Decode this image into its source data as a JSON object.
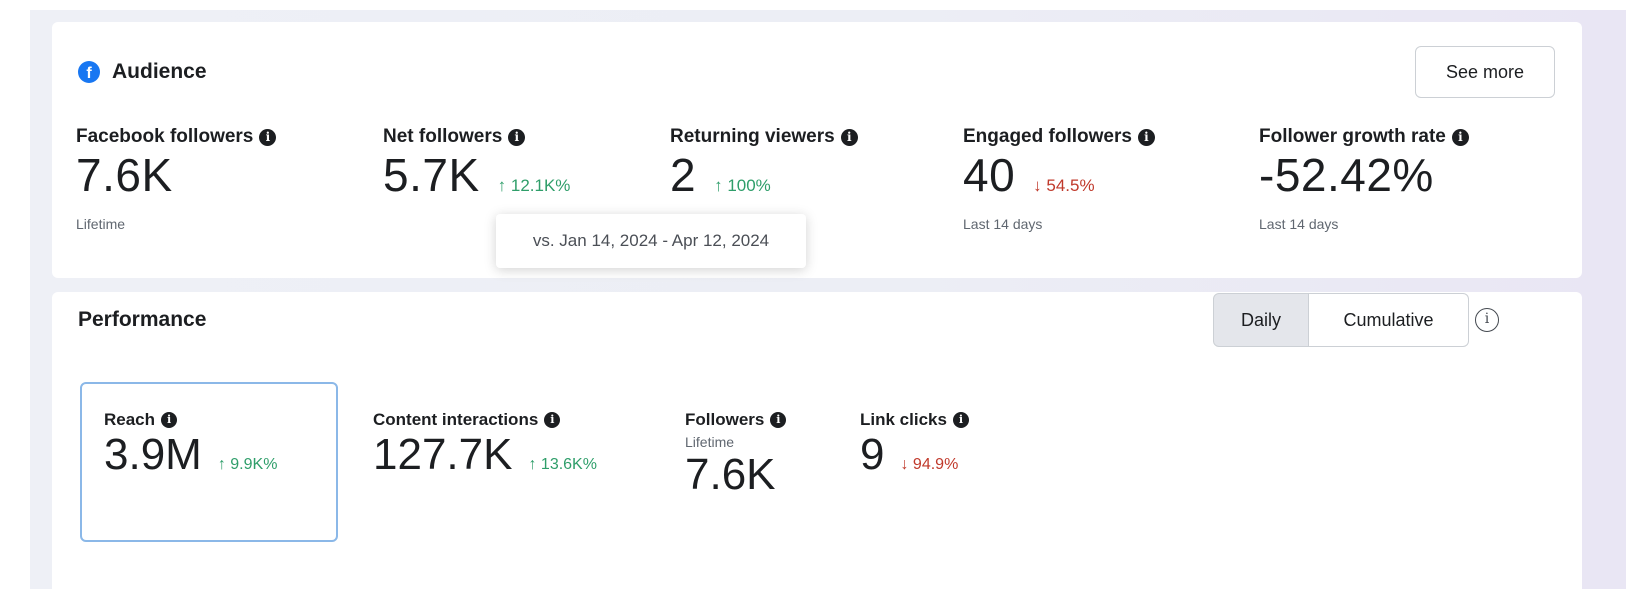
{
  "audience": {
    "title": "Audience",
    "see_more_label": "See more",
    "metrics": [
      {
        "label": "Facebook followers",
        "value": "7.6K",
        "delta": "",
        "sub": "Lifetime"
      },
      {
        "label": "Net followers",
        "value": "5.7K",
        "delta": "↑ 12.1K%",
        "sub": ""
      },
      {
        "label": "Returning viewers",
        "value": "2",
        "delta": "↑ 100%",
        "sub": ""
      },
      {
        "label": "Engaged followers",
        "value": "40",
        "delta": "↓ 54.5%",
        "sub": "Last 14 days"
      },
      {
        "label": "Follower growth rate",
        "value": "-52.42%",
        "delta": "",
        "sub": "Last 14 days"
      }
    ],
    "tooltip": "vs. Jan 14, 2024 - Apr 12, 2024"
  },
  "performance": {
    "title": "Performance",
    "daily_label": "Daily",
    "cumulative_label": "Cumulative",
    "metrics": [
      {
        "label": "Reach",
        "value": "3.9M",
        "delta": "↑ 9.9K%",
        "sub": ""
      },
      {
        "label": "Content interactions",
        "value": "127.7K",
        "delta": "↑ 13.6K%",
        "sub": ""
      },
      {
        "label": "Followers",
        "value": "7.6K",
        "delta": "",
        "sub": "Lifetime"
      },
      {
        "label": "Link clicks",
        "value": "9",
        "delta": "↓ 94.9%",
        "sub": ""
      }
    ]
  },
  "colors": {
    "brand": "#1877f2",
    "positive": "#2f9e6a",
    "negative": "#c0392b",
    "selected_border": "#8bb8e8"
  },
  "icons": {
    "brand": "facebook-logo-icon",
    "info": "info-icon",
    "info_outline": "info-outline-icon"
  }
}
